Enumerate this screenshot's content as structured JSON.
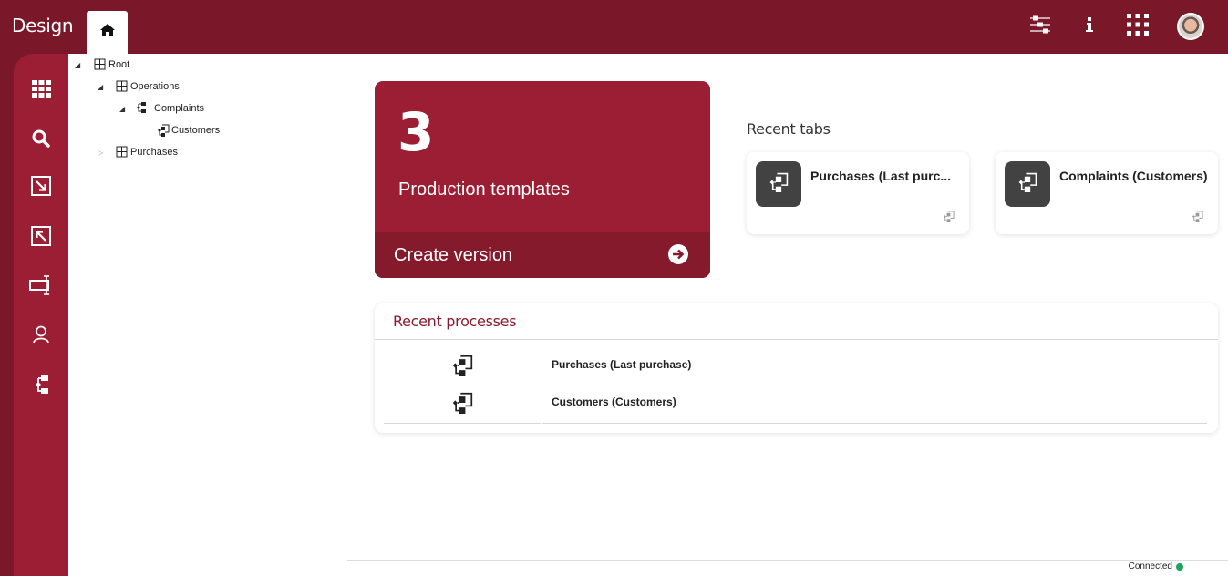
{
  "app": {
    "title": "Design",
    "home_tab_icon": "home-icon",
    "top_icons": [
      "sliders-icon",
      "info-icon",
      "apps-grid-icon",
      "user-avatar"
    ]
  },
  "sidebar": {
    "items": [
      {
        "name": "dashboard",
        "icon": "grid-icon"
      },
      {
        "name": "search",
        "icon": "search-icon"
      },
      {
        "name": "import",
        "icon": "import-arrow-icon"
      },
      {
        "name": "export",
        "icon": "export-arrow-icon"
      },
      {
        "name": "field-editor",
        "icon": "text-field-icon"
      },
      {
        "name": "users",
        "icon": "user-icon"
      },
      {
        "name": "process-tree",
        "icon": "hierarchy-icon"
      }
    ]
  },
  "tree": {
    "nodes": [
      {
        "label": "Root",
        "level": 0,
        "toggle": "expanded",
        "icon": "folder-grid-icon"
      },
      {
        "label": "Operations",
        "level": 1,
        "toggle": "expanded",
        "icon": "folder-grid-icon"
      },
      {
        "label": "Complaints",
        "level": 2,
        "toggle": "expanded",
        "icon": "hierarchy-icon"
      },
      {
        "label": "Customers",
        "level": 3,
        "toggle": "none",
        "icon": "process-icon"
      },
      {
        "label": "Purchases",
        "level": 1,
        "toggle": "collapsed",
        "icon": "folder-grid-icon"
      }
    ]
  },
  "production_card": {
    "count": "3",
    "label": "Production templates",
    "action_label": "Create version",
    "action_icon": "arrow-right-circle-icon"
  },
  "recent_tabs": {
    "title": "Recent tabs",
    "items": [
      {
        "label": "Purchases (Last purc...",
        "full_label": "Purchases (Last purchase)"
      },
      {
        "label": "Complaints (Customers)",
        "full_label": "Complaints (Customers)"
      }
    ]
  },
  "recent_processes": {
    "title": "Recent processes",
    "items": [
      {
        "label": "Purchases (Last purchase)"
      },
      {
        "label": "Customers (Customers)"
      }
    ]
  },
  "status": {
    "label": "Connected",
    "color": "#1aa65a"
  },
  "colors": {
    "brand_dark": "#7a1829",
    "brand": "#9b1e34",
    "brand_footer": "#861a2d",
    "tile_dark": "#424242"
  }
}
